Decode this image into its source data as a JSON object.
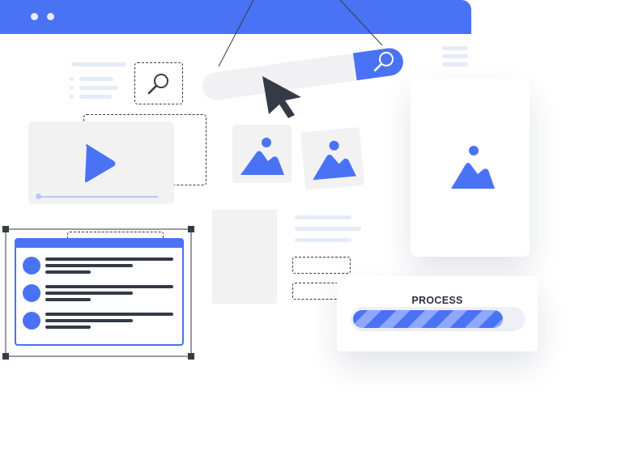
{
  "process_card": {
    "label": "PROCESS",
    "progress": 0.88
  },
  "icons": {
    "browser_dots": "window-control-dots",
    "search": "magnifier-icon",
    "cursor": "arrow-cursor-icon",
    "play": "play-icon",
    "image": "image-icon",
    "menu": "hamburger-icon"
  },
  "colors": {
    "accent": "#4a72f5",
    "accent_light": "#8ea8ff",
    "dark": "#343a46",
    "placeholder": "#f2f2f2"
  }
}
